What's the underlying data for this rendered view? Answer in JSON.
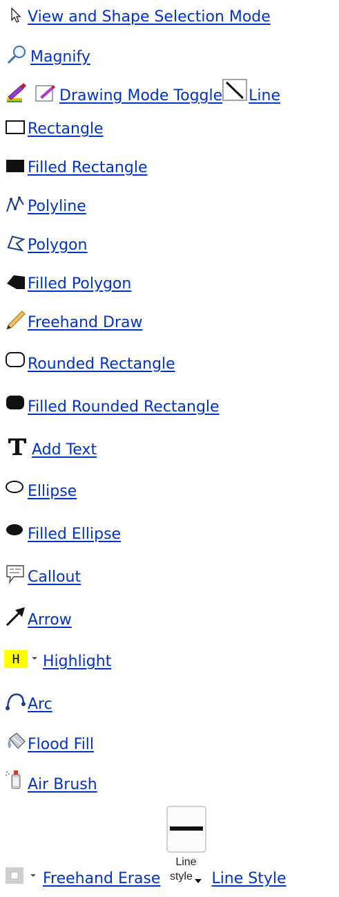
{
  "items": [
    {
      "label": "View and Shape Selection Mode",
      "icon": "pointer-icon"
    },
    {
      "label": "Magnify",
      "icon": "magnifier-icon"
    },
    {
      "label": "Drawing Mode Toggle",
      "icon": "pen-toggle-icon"
    },
    {
      "label": "Line",
      "icon": "line-icon"
    },
    {
      "label": "Rectangle",
      "icon": "rectangle-icon"
    },
    {
      "label": "Filled Rectangle",
      "icon": "filled-rectangle-icon"
    },
    {
      "label": "Polyline",
      "icon": "polyline-icon"
    },
    {
      "label": "Polygon",
      "icon": "polygon-icon"
    },
    {
      "label": "Filled Polygon",
      "icon": "filled-polygon-icon"
    },
    {
      "label": "Freehand Draw",
      "icon": "pencil-icon"
    },
    {
      "label": "Rounded Rectangle",
      "icon": "rounded-rectangle-icon"
    },
    {
      "label": "Filled Rounded Rectangle",
      "icon": "filled-rounded-rectangle-icon"
    },
    {
      "label": "Add Text",
      "icon": "text-icon"
    },
    {
      "label": "Ellipse",
      "icon": "ellipse-icon"
    },
    {
      "label": "Filled Ellipse",
      "icon": "filled-ellipse-icon"
    },
    {
      "label": "Callout",
      "icon": "callout-icon"
    },
    {
      "label": "Arrow",
      "icon": "arrow-icon"
    },
    {
      "label": "Highlight",
      "icon": "highlight-icon",
      "icon_text": "H"
    },
    {
      "label": "Arc",
      "icon": "arc-icon"
    },
    {
      "label": "Flood Fill",
      "icon": "bucket-icon"
    },
    {
      "label": "Air Brush",
      "icon": "airbrush-icon"
    },
    {
      "label": "Freehand Erase",
      "icon": "eraser-icon"
    },
    {
      "label": "Line Style",
      "icon": "line-style-icon",
      "icon_text_top": "Line",
      "icon_text_bottom": "style"
    }
  ],
  "colors": {
    "link": "#0033cc",
    "highlight_yellow": "#ffff00",
    "icon_dark": "#111111"
  }
}
